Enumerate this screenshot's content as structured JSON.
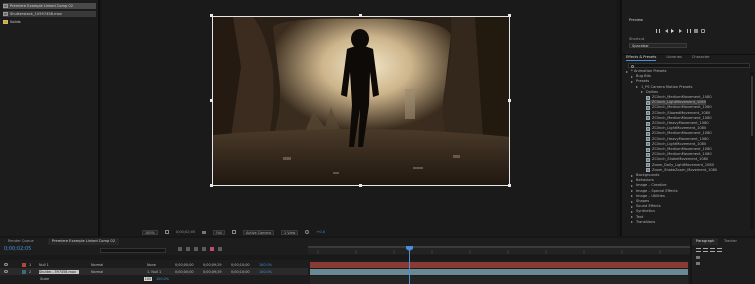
{
  "project": {
    "items": [
      {
        "label": "Premiere Example Linked Comp 02",
        "icon": "composition-icon",
        "selected": true
      },
      {
        "label": "Shutterstock_10597458.mov",
        "icon": "footage-icon",
        "selected": true
      },
      {
        "label": "Solids",
        "icon": "folder-icon",
        "selected": false
      }
    ]
  },
  "composition": {
    "scene_description_colors": {
      "bg": "#2b2218",
      "light": "#e8d6b4"
    },
    "toolbar": {
      "zoom": "100%",
      "timecode": "0;00;02;05",
      "resolution": "Full",
      "camera": "Active Camera",
      "views": "1 View",
      "exposure": "+0.0"
    }
  },
  "preview": {
    "title": "Preview",
    "shortcut_label": "Shortcut",
    "shortcut_value": "Spacebar"
  },
  "effects_panel": {
    "tabs": [
      "Effects & Presets",
      "Libraries",
      "Character"
    ],
    "search_placeholder": "",
    "tree": [
      {
        "label": "* Animation Presets",
        "depth": 0
      },
      {
        "label": "Bug Bits",
        "depth": 1
      },
      {
        "label": "Presets",
        "depth": 1
      },
      {
        "label": "1_PS Camera Motion Presets",
        "depth": 2
      },
      {
        "label": "Dollies",
        "depth": 3
      },
      {
        "label": "ZClinch_MediumMovement_1080",
        "depth": 4
      },
      {
        "label": "ZClinch_LightMovement_1080",
        "depth": 4,
        "selected": true
      },
      {
        "label": "ZClinch_MediumMovement_1080",
        "depth": 4
      },
      {
        "label": "ZClinch_SlowedMovement_1080",
        "depth": 4
      },
      {
        "label": "ZClinch_MediumMovement_1080",
        "depth": 4
      },
      {
        "label": "ZClinch_HeavyMovement_1080",
        "depth": 4
      },
      {
        "label": "ZClinch_LightMovement_1080",
        "depth": 4
      },
      {
        "label": "ZClinch_MediumMovement_1080",
        "depth": 4
      },
      {
        "label": "ZClinch_HeavyMovement_1080",
        "depth": 4
      },
      {
        "label": "ZClinch_LightMovement_1080",
        "depth": 4
      },
      {
        "label": "ZClinch_MediumMovement_1080",
        "depth": 4
      },
      {
        "label": "ZClinch_MediumMovement_1080",
        "depth": 4
      },
      {
        "label": "ZClinch_ShakeMovement_1080",
        "depth": 4
      },
      {
        "label": "Zoom_Dolly_LightMovement_1080",
        "depth": 4
      },
      {
        "label": "Zoom_ShakeZoom_Movement_1080",
        "depth": 4
      },
      {
        "label": "Backgrounds",
        "depth": 1
      },
      {
        "label": "Behaviors",
        "depth": 1
      },
      {
        "label": "Image – Creative",
        "depth": 1
      },
      {
        "label": "Image – Special Effects",
        "depth": 1
      },
      {
        "label": "Image – Utilities",
        "depth": 1
      },
      {
        "label": "Shapes",
        "depth": 1
      },
      {
        "label": "Sound Effects",
        "depth": 1
      },
      {
        "label": "Synthetics",
        "depth": 1
      },
      {
        "label": "Text",
        "depth": 1
      },
      {
        "label": "Transitions",
        "depth": 1
      }
    ]
  },
  "timeline": {
    "tabs": [
      "Render Queue",
      "Premiere Example Linked Comp 02"
    ],
    "current_time": "0;00;02;05",
    "layers": [
      {
        "num": "1",
        "name": "Null 1",
        "mode": "Normal",
        "parent": "None",
        "in": "0;00;00;00",
        "out": "0;00;09;29",
        "duration": "0;00;10;00",
        "stretch": "100.0%",
        "color": "#b5453a"
      },
      {
        "num": "2",
        "name": "Shutter...597458.mov",
        "mode": "Normal",
        "parent": "1. Null 1",
        "in": "0;00;00;00",
        "out": "0;00;09;29",
        "duration": "0;00;10;00",
        "stretch": "100.0%",
        "color": "#3e6d7a"
      }
    ],
    "sub_row": {
      "label": "Scale",
      "value": "100",
      "value2": "100.0%"
    }
  },
  "paragraph": {
    "tabs": [
      "Paragraph",
      "Tracker"
    ]
  }
}
